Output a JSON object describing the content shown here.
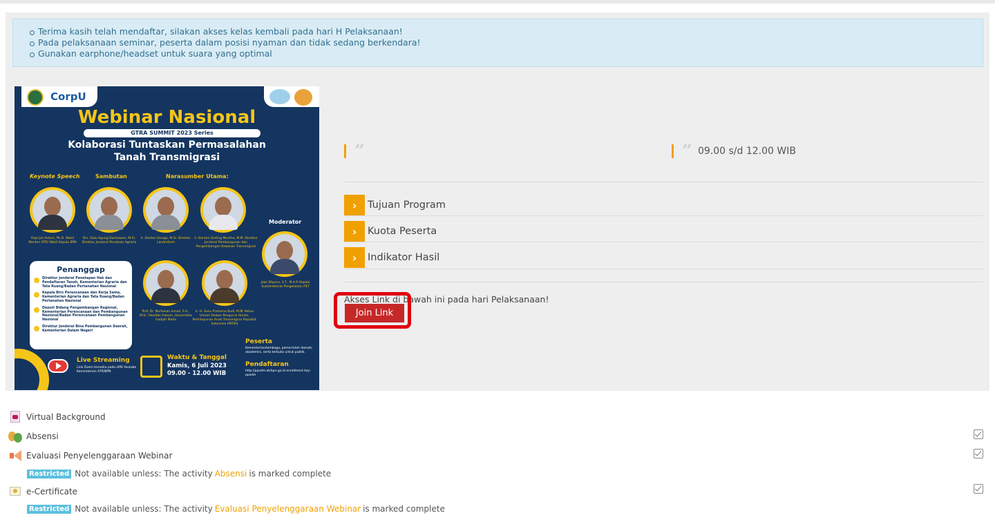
{
  "alert": {
    "items": [
      "Terima kasih telah mendaftar, silakan akses kelas kembali pada hari H Pelaksanaan!",
      "Pada pelaksanaan seminar, peserta dalam posisi nyaman dan tidak sedang berkendara!",
      "Gunakan earphone/headset untuk suara yang optimal"
    ]
  },
  "poster": {
    "logo_left": "CorpU",
    "title": "Webinar Nasional",
    "series": "GTRA SUMMIT 2023 Series",
    "subtitle_1": "Kolaborasi Tuntaskan Permasalahan",
    "subtitle_2": "Tanah Transmigrasi",
    "keynote": "Keynote Speech",
    "sambutan": "Sambutan",
    "narasumber": "Narasumber Utama:",
    "moderator": "Moderator",
    "captions": [
      "Raja Juli Antoni, Ph.D. Wakil Menteri ATR/ Wakil Kepala BPN",
      "Drs. Dalu Agung Darmawan, M.Si. Direktur Jenderal Penataan Agraria",
      "Ir. Danton Sinaga, M.Si. Direktur Landreform",
      "Ir. Danton Ginting Munthe, M.M. Direktur Jenderal Pembangunan dan Pengembangan Kawasan Transmigrasi",
      "Joko Wiyono, S.T., M.A.P. Kepala Subdirektorat Pengelolaan P4T",
      "Prof. Dr. Nurhasan Ismail, S.H., M.Si. Fakultas Hukum, Universitas Gadjah Mada",
      "Ir. H. Sunu Pramono Budi, M.M. Ketua Umum Dewan Pengurus Harian, Perhimpunan Anak Transmigran Republik Indonesia (PATRI)"
    ],
    "penanggap_title": "Penanggap",
    "penanggap": [
      "Direktur Jenderal Penetapan Hak dan Pendaftaran Tanah, Kementerian Agraria dan Tata Ruang/Badan Pertanahan Nasional",
      "Kepala Biro Perencanaan dan Kerja Sama, Kementerian Agraria dan Tata Ruang/Badan Pertanahan Nasional",
      "Deputi Bidang Pengembangan Regional, Kementerian Perencanaan dan Pembangunan Nasional/Badan Perencanaan Pembangunan Nasional",
      "Direktur Jenderal Bina Pembangunan Daerah, Kementerian Dalam Negeri"
    ],
    "live_title": "Live Streaming",
    "live_sub": "Link Zoom tersedia pada LMS Youtube Kementerian ATR/BPN",
    "waktu_title": "Waktu & Tanggal",
    "waktu_date": "Kamis, 6 Juli 2023",
    "waktu_time": "09.00 - 12.00 WIB",
    "peserta_title": "Peserta",
    "peserta_sub": "Kementerian/lembaga, pemerintah daerah, akademisi, serta terbuka untuk publik.",
    "pendaftaran_title": "Pendaftaran",
    "pendaftaran_sub": "http://ppsdm.atrbpn.go.id enrollment key: ppsdm"
  },
  "info": {
    "quote_left": "",
    "quote_right": "09.00 s/d 12.00 WIB"
  },
  "accordion": [
    "Tujuan Program",
    "Kuota Peserta",
    "Indikator Hasil"
  ],
  "akses_text": "Akses Link di bawah ini pada hari Pelaksanaan!",
  "join_label": "Join Link",
  "activities": {
    "virtual_background": "Virtual Background",
    "absensi": "Absensi",
    "evaluasi": "Evaluasi Penyelenggaraan Webinar",
    "ecert": "e-Certificate"
  },
  "restricted": {
    "badge": "Restricted",
    "prefix": "Not available unless: The activity",
    "suffix": "is marked complete",
    "r1_link": "Absensi",
    "r2_link": "Evaluasi Penyelenggaraan Webinar"
  },
  "colors": {
    "accent": "#f0a000",
    "join_button": "#c62828",
    "restricted_badge": "#5bc0de",
    "poster_bg": "#143560"
  }
}
